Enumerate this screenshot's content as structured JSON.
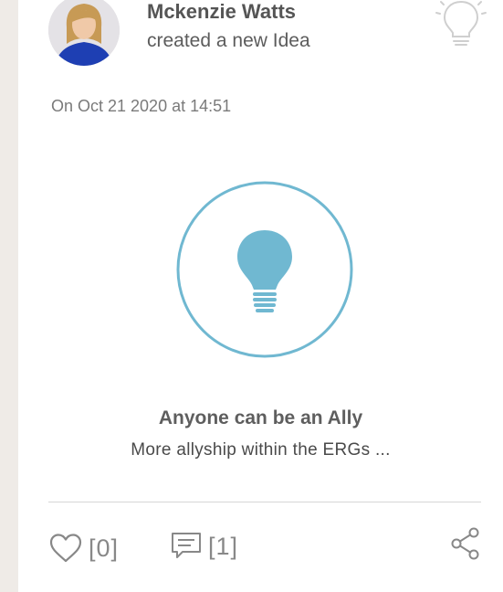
{
  "post": {
    "author_name": "Mckenzie Watts",
    "action_text": "created a new Idea",
    "timestamp": "On Oct 21 2020 at 14:51",
    "idea_type_icon": "lightbulb-outline-icon",
    "hero_icon": "lightbulb-circle-icon"
  },
  "idea": {
    "title": "Anyone can be an Ally",
    "excerpt": "More allyship within the ERGs ..."
  },
  "actions": {
    "like_count": "[0]",
    "comment_count": "[1]",
    "like_icon": "heart-outline-icon",
    "comment_icon": "comment-icon",
    "share_icon": "share-icon"
  },
  "colors": {
    "accent": "#70b8d1",
    "rail": "#efebe7",
    "muted_text": "#888888"
  }
}
